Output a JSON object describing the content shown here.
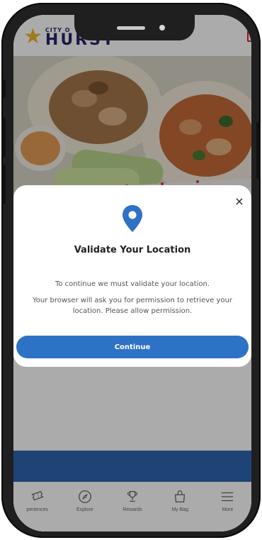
{
  "header": {
    "logo_top": "CITY O",
    "logo_main": "HURST"
  },
  "modal": {
    "title": "Validate Your Location",
    "text_primary": "To continue we must validate your location.",
    "text_secondary": "Your browser will ask you for permission to retrieve your location. Please allow permission.",
    "button_label": "Continue",
    "close_symbol": "×"
  },
  "bottom_nav": {
    "items": [
      {
        "label": "periences",
        "icon": "ticket-icon"
      },
      {
        "label": "Explore",
        "icon": "compass-icon"
      },
      {
        "label": "Rewards",
        "icon": "trophy-icon"
      },
      {
        "label": "My Bag",
        "icon": "shopping-bag-icon"
      },
      {
        "label": "More",
        "icon": "menu-icon"
      }
    ]
  },
  "colors": {
    "primary_blue": "#2e72c6",
    "bar_blue": "#2e66b0",
    "logo_navy": "#24246a",
    "logo_star": "#f3b52b"
  }
}
